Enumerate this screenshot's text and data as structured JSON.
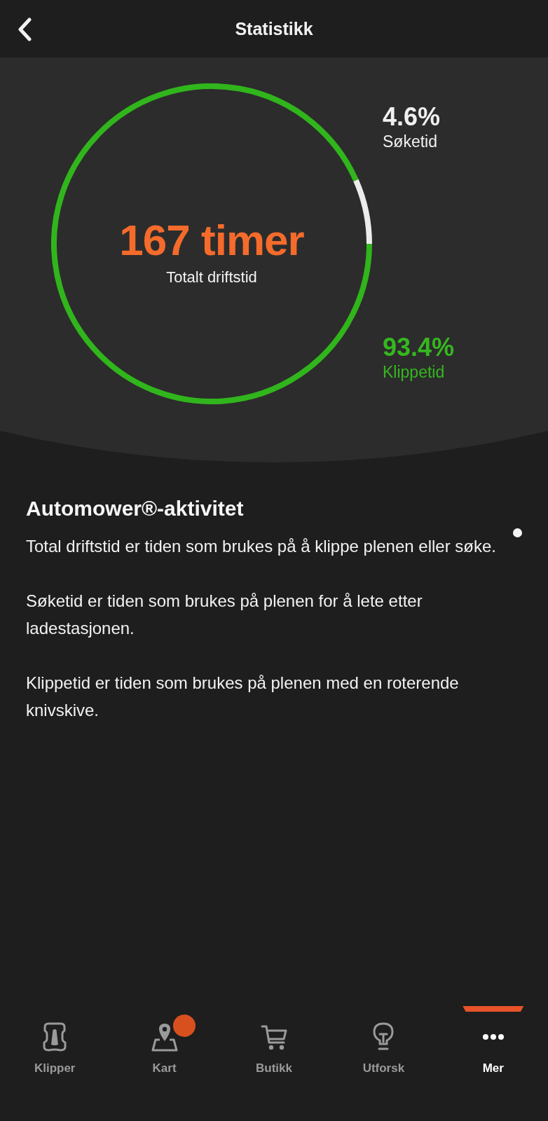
{
  "top_bar": {
    "title": "Statistikk"
  },
  "stats": {
    "total_value": "167 timer",
    "total_label": "Totalt driftstid",
    "ring": {
      "level": 0.934
    },
    "legend": [
      {
        "value": "4.6%",
        "label": "Søketid",
        "color": "#f0f0f0"
      },
      {
        "value": "93.4%",
        "label": "Klippetid",
        "color": "#35b71f"
      }
    ]
  },
  "info": {
    "title": "Automower®-aktivitet",
    "paragraphs": [
      "Total driftstid er tiden som brukes på å klippe plenen eller søke.",
      "Søketid er tiden som brukes på plenen for å lete etter ladestasjonen.",
      "Klippetid er tiden som brukes på plenen med en roterende knivskive."
    ]
  },
  "nav": {
    "tabs": [
      {
        "label": "Klipper",
        "selected": false,
        "badge": false
      },
      {
        "label": "Kart",
        "selected": false,
        "badge": true
      },
      {
        "label": "Butikk",
        "selected": false,
        "badge": false
      },
      {
        "label": "Utforsk",
        "selected": false,
        "badge": false
      },
      {
        "label": "Mer",
        "selected": true,
        "badge": false
      }
    ]
  }
}
